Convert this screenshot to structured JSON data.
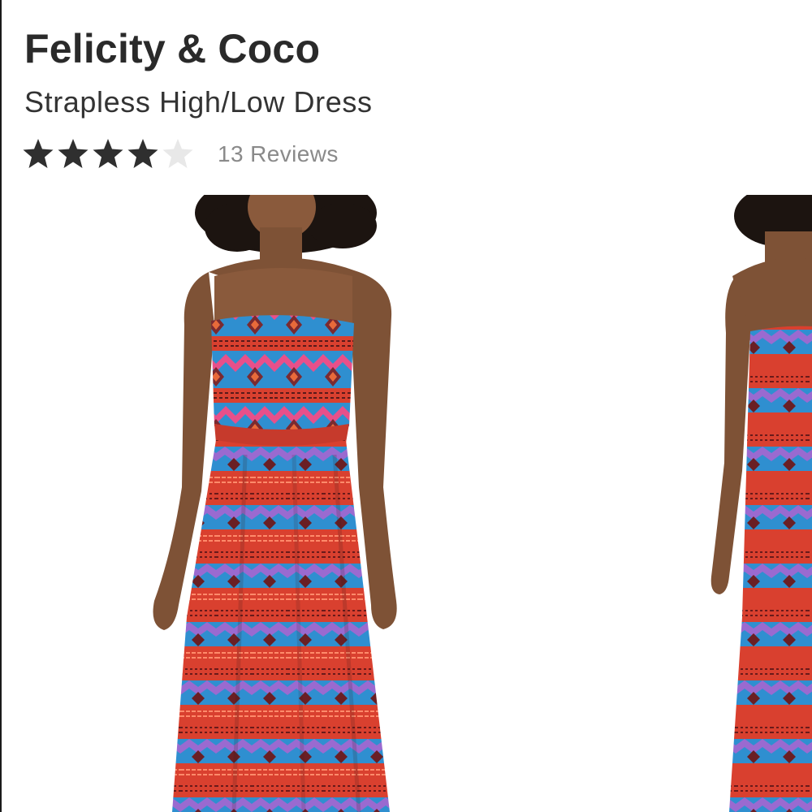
{
  "product": {
    "brand": "Felicity & Coco",
    "name": "Strapless High/Low Dress"
  },
  "rating": {
    "value": 4,
    "max": 5,
    "reviews_label": "13 Reviews"
  },
  "gallery": {
    "images": [
      {
        "name": "front-view",
        "description_icon": "dress-front-photo"
      },
      {
        "name": "back-view",
        "description_icon": "dress-back-photo"
      }
    ]
  },
  "colors": {
    "text_primary": "#2a2a2a",
    "text_secondary": "#8a8a8a",
    "star_filled": "#2f2f2f",
    "star_empty": "#e8e8e8",
    "dress_blue": "#2f8fd0",
    "dress_red": "#d9402f",
    "dress_pink": "#e8508a"
  }
}
